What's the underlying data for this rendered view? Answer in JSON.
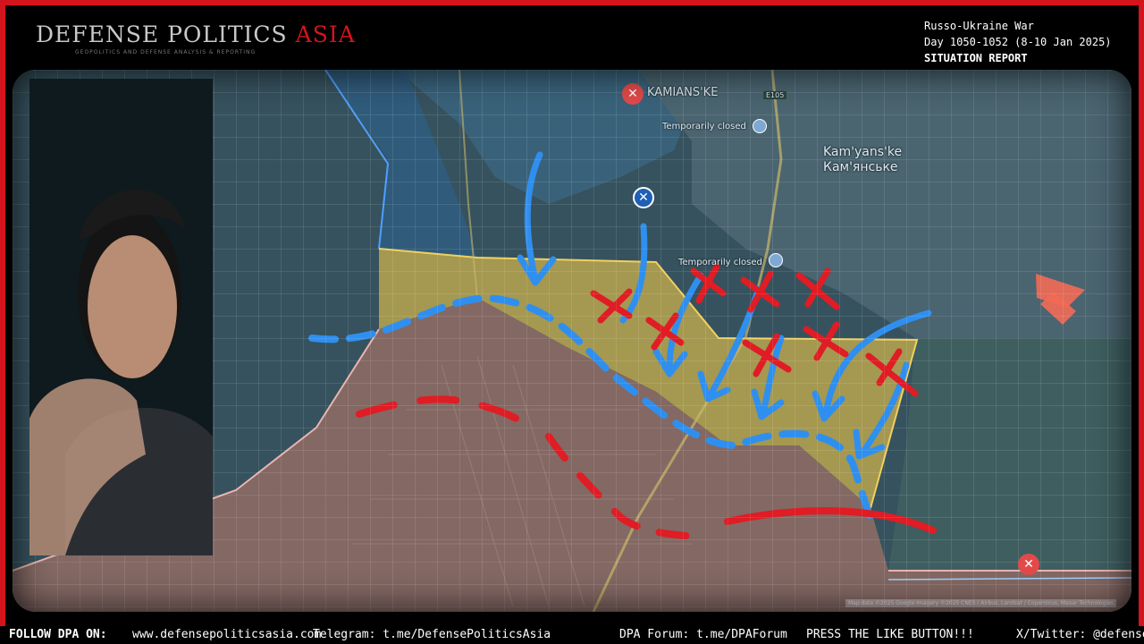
{
  "header": {
    "logo_main": "DEFENSE POLITICS",
    "logo_accent": "ASIA",
    "tagline": "GEOPOLITICS AND DEFENSE ANALYSIS & REPORTING",
    "report_line1": "Russo-Ukraine War",
    "report_line2": "Day 1050-1052 (8-10 Jan 2025)",
    "report_line3": "SITUATION REPORT"
  },
  "map": {
    "labels": {
      "kamianske_upper": "KAMIANS'KE",
      "temp_closed_1": "Temporarily closed",
      "kamianske_latin": "Kam'yans'ke",
      "kamianske_cyrillic": "Кам'янське",
      "temp_closed_2": "Temporarily closed",
      "road": "E105"
    },
    "credit": "Map data ©2025 Google Imagery ©2025 CNES / Airbus, Landsat / Copernicus, Maxar Technologies",
    "colors": {
      "ukraine_control": "#2f5f86",
      "contested": "#d4b64a",
      "russia_control": "#8a6a64",
      "ua_arrow": "#2f8fef",
      "ru_marker": "#e01c24"
    }
  },
  "ticker": {
    "lead": "FOLLOW DPA ON:",
    "website": "www.defensepoliticsasia.com",
    "telegram": "Telegram: t.me/DefensePoliticsAsia",
    "forum": "DPA Forum: t.me/DPAForum",
    "like": "PRESS THE LIKE BUTTON!!!",
    "twitter": "X/Twitter: @defensepoliticsasia"
  }
}
